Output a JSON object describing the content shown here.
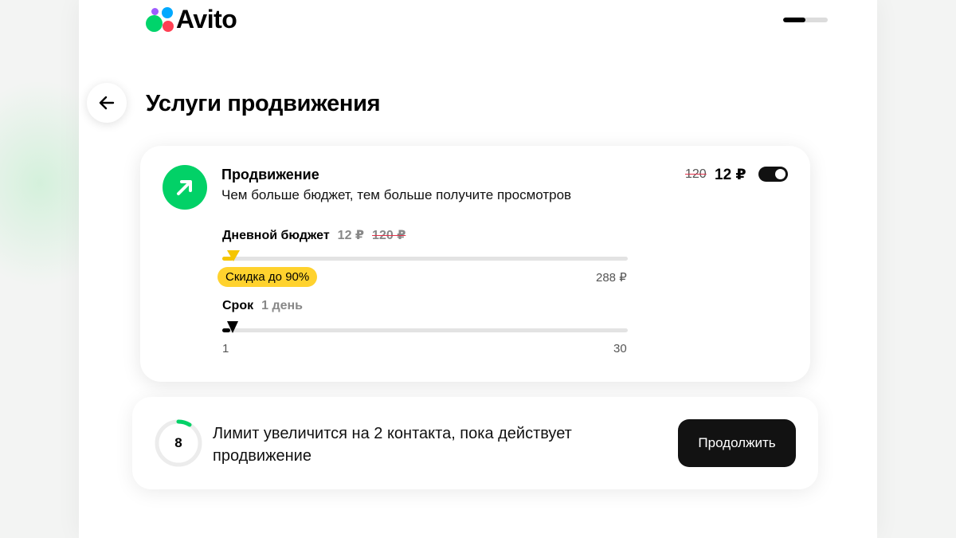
{
  "brand": {
    "logo_text": "Avito"
  },
  "header": {
    "step_progress": 0.5
  },
  "page": {
    "title": "Услуги продвижения"
  },
  "promotion": {
    "title": "Продвижение",
    "description": "Чем больше бюджет, тем больше получите просмотров",
    "price_old": "120",
    "price_new": "12 ₽",
    "enabled": true,
    "budget": {
      "label": "Дневной бюджет",
      "value": "12 ₽",
      "value_old": "120 ₽",
      "discount_badge": "Скидка до 90%",
      "max_label": "288 ₽"
    },
    "term": {
      "label": "Срок",
      "value": "1 день",
      "min_label": "1",
      "max_label": "30"
    }
  },
  "limit": {
    "count": "8",
    "text": "Лимит увеличится на 2 контакта, пока действует продвижение"
  },
  "actions": {
    "continue_label": "Продолжить"
  },
  "colors": {
    "accent_green": "#02d167",
    "discount_yellow": "#ffd22e",
    "strike_red": "#e0324a",
    "button_dark": "#121212"
  }
}
